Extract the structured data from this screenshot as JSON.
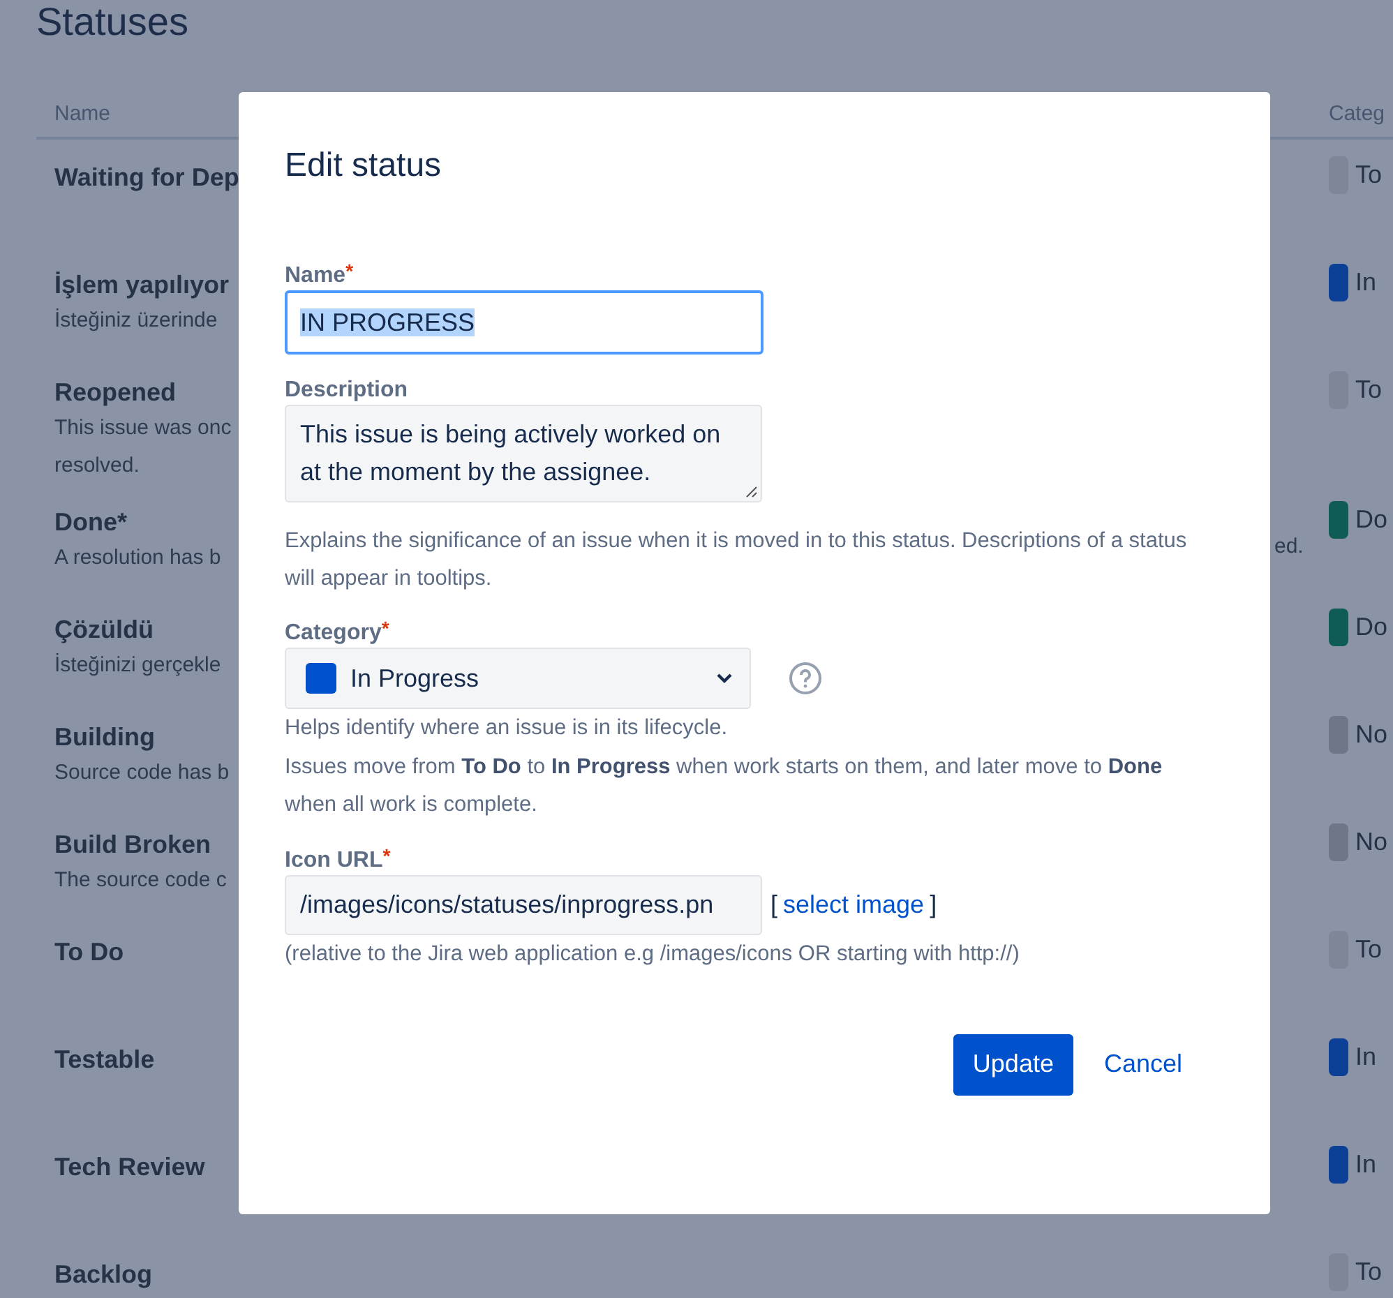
{
  "page": {
    "title": "Statuses",
    "columns": [
      "Name",
      "Categ"
    ]
  },
  "statuses": [
    {
      "name": "Waiting for Dep",
      "category": "To",
      "color": "#7d8798"
    },
    {
      "name": "İşlem yapılıyor",
      "description": [
        "İsteğiniz üzerinde"
      ],
      "category": "In",
      "color": "#0c3f96"
    },
    {
      "name": "Reopened",
      "description": [
        "This issue was onc",
        "resolved."
      ],
      "category": "To",
      "color": "#7d8798"
    },
    {
      "name": "Done*",
      "description": [
        "A resolution has b"
      ],
      "description_end": "ed.",
      "category": "Do",
      "color": "#0f5c54"
    },
    {
      "name": "Çözüldü",
      "description": [
        "İsteğinizi gerçekle"
      ],
      "category": "Do",
      "color": "#0f5c54"
    },
    {
      "name": "Building",
      "description": [
        "Source code has b"
      ],
      "category": "No",
      "color": "#6e7687"
    },
    {
      "name": "Build Broken",
      "description": [
        "The source code c"
      ],
      "category": "No",
      "color": "#6e7687"
    },
    {
      "name": "To Do",
      "category": "To",
      "color": "#7d8798"
    },
    {
      "name": "Testable",
      "category": "In",
      "color": "#0c3f96"
    },
    {
      "name": "Tech Review",
      "category": "In",
      "color": "#0c3f96"
    },
    {
      "name": "Backlog",
      "category": "To",
      "color": "#7d8798"
    }
  ],
  "dialog": {
    "title": "Edit status",
    "fields": [
      {
        "kind": "text",
        "label": "Name",
        "required_mark": "*",
        "value": "IN PROGRESS",
        "selected": true
      },
      {
        "kind": "textarea",
        "label": "Description",
        "value": "This issue is being actively worked on at the moment by the assignee.",
        "help": [
          "Explains the significance of an issue when it is moved in to this status. Descriptions of a status will appear in tooltips."
        ]
      },
      {
        "kind": "select",
        "label": "Category",
        "required_mark": "*",
        "value": "In Progress",
        "color": "#0052cc",
        "help": [
          "Helps identify where an issue is in its lifecycle.",
          "Issues move from **To Do** to **In Progress** when work starts on them, and later move to **Done** when all work is complete."
        ]
      },
      {
        "kind": "url",
        "label": "Icon URL",
        "required_mark": "*",
        "value": "/images/icons/statuses/inprogress.pn",
        "link_open": "[",
        "link": "select image",
        "link_close": "]",
        "help": [
          "(relative to the Jira web application e.g /images/icons OR starting with http://)"
        ]
      }
    ],
    "buttons": [
      {
        "kind": "primary",
        "label": "Update"
      },
      {
        "kind": "link",
        "label": "Cancel"
      }
    ]
  }
}
